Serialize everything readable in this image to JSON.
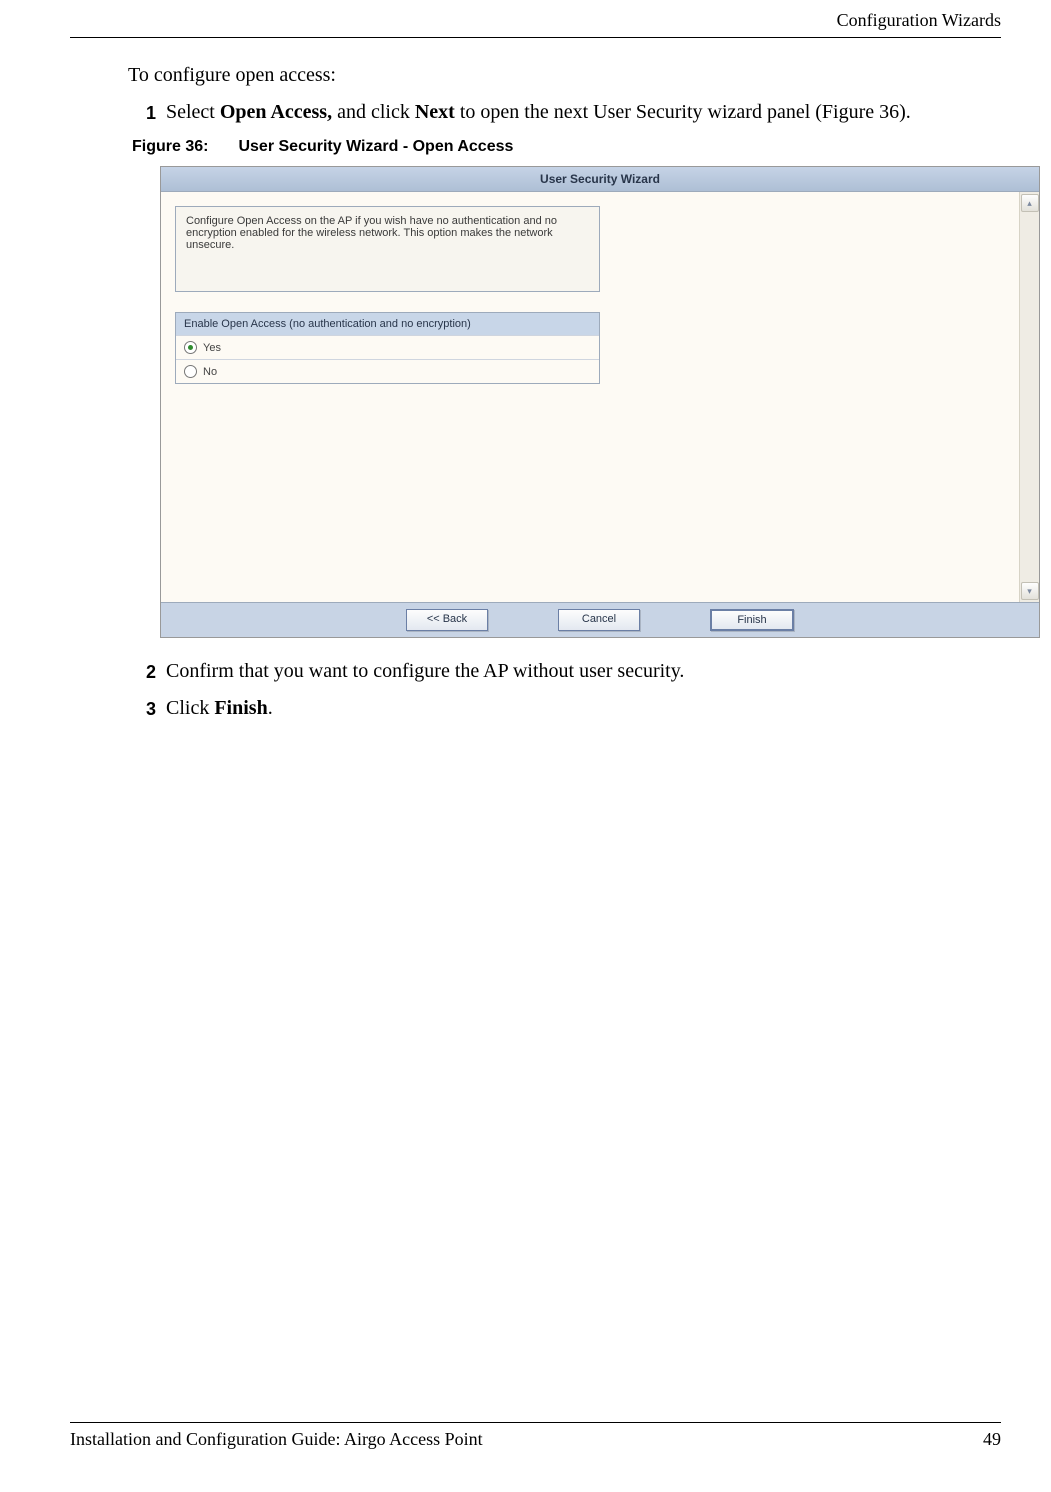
{
  "header": {
    "section_title": "Configuration Wizards"
  },
  "footer": {
    "doc_title": "Installation and Configuration Guide: Airgo Access Point",
    "page_number": "49"
  },
  "body": {
    "intro": "To configure open access:",
    "steps": {
      "s1": {
        "num": "1",
        "pre": "Select ",
        "b1": "Open Access,",
        "mid": " and click ",
        "b2": "Next",
        "post": " to open the next User Security wizard panel (Figure 36)."
      },
      "s2": {
        "num": "2",
        "text": "Confirm that you want to configure the AP without user security."
      },
      "s3": {
        "num": "3",
        "pre": "Click ",
        "b1": "Finish",
        "post": "."
      }
    },
    "figure": {
      "label": "Figure 36:",
      "caption": "User Security Wizard - Open Access"
    }
  },
  "wizard": {
    "title": "User Security Wizard",
    "message": "Configure Open Access on the AP if you wish have no authentication and no encryption enabled for the wireless network. This option makes the network unsecure.",
    "question": "Enable Open Access (no authentication and no encryption)",
    "option_yes": "Yes",
    "option_no": "No",
    "selected": "yes",
    "buttons": {
      "back": "<< Back",
      "cancel": "Cancel",
      "finish": "Finish"
    }
  }
}
